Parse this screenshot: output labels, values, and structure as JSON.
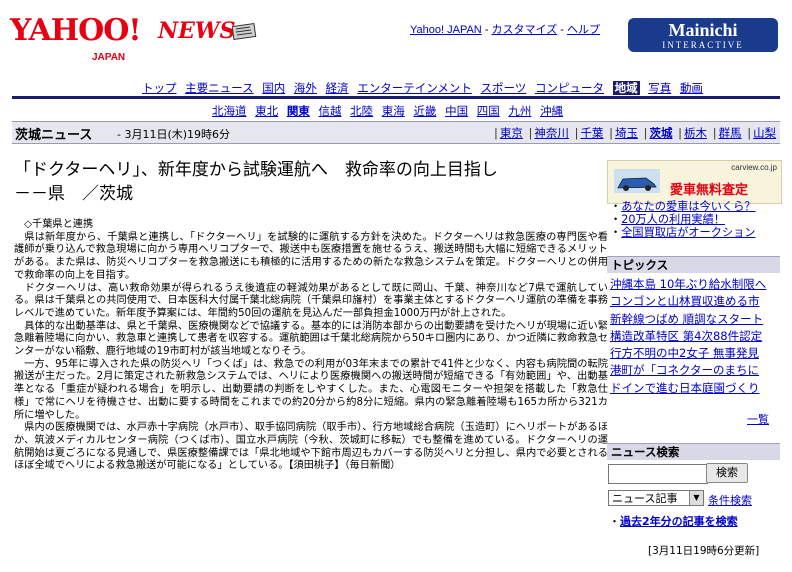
{
  "header": {
    "yahoo_logo": "YAHOO!",
    "yahoo_sub": "JAPAN",
    "news_logo": "NEWS",
    "top_links": [
      "Yahoo! JAPAN",
      "カスタマイズ",
      "ヘルプ"
    ],
    "partner_logo_1": "Mainichi",
    "partner_logo_2": "INTERACTIVE"
  },
  "nav": {
    "categories": [
      "トップ",
      "主要ニュース",
      "国内",
      "海外",
      "経済",
      "エンターテインメント",
      "スポーツ",
      "コンピュータ",
      "地域",
      "写真",
      "動画"
    ],
    "selected": "地域",
    "regions": [
      "北海道",
      "東北",
      "関東",
      "信越",
      "北陸",
      "東海",
      "近畿",
      "中国",
      "四国",
      "九州",
      "沖縄"
    ],
    "selected_region": "関東"
  },
  "section": {
    "title": "茨城ニュース",
    "date": " - 3月11日(木)19時6分",
    "prefectures": [
      "東京",
      "神奈川",
      "千葉",
      "埼玉",
      "茨城",
      "栃木",
      "群馬",
      "山梨"
    ],
    "selected_prefecture": "茨城"
  },
  "article": {
    "headline_1": "「ドクターヘリ」、新年度から試験運航へ　救命率の向上目指し",
    "headline_2": "－－県　／茨城",
    "paragraphs": [
      "　◇千葉県と連携",
      "　県は新年度から、千葉県と連携し、「ドクターヘリ」を試験的に運航する方針を決めた。ドクターヘリは救急医療の専門医や看護師が乗り込んで救急現場に向かう専用ヘリコプターで、搬送中も医療措置を施せるうえ、搬送時間も大幅に短縮できるメリットがある。また県は、防災ヘリコプターを救急搬送にも積極的に活用するための新たな救急システムを策定。ドクターヘリとの併用で救命率の向上を目指す。",
      "　ドクターヘリは、高い救命効果が得られるうえ後遺症の軽減効果があるとして既に岡山、千葉、神奈川など7県で運航している。県は千葉県との共同使用で、日本医科大付属千葉北総病院（千葉県印旛村）を事業主体とするドクターヘリ運航の準備を事務レベルで進めていた。新年度予算案には、年間約50回の運航を見込んだ一部負担金1000万円が計上された。",
      "　具体的な出動基準は、県と千葉県、医療機関などで協議する。基本的には消防本部からの出動要請を受けたヘリが現場に近い緊急離着陸場に向かい、救急車と連携して患者を収容する。運航範囲は千葉北総病院から50キロ圏内にあり、かつ近隣に救命救急センターがない稲敷、鹿行地域の19市町村が該当地域となりそう。",
      "　一方、95年に導入された県の防災ヘリ「つくば」は、救急での利用が03年末までの累計で41件と少なく、内容も病院間の転院搬送が主だった。2月に策定された新救急システムでは、ヘリにより医療機関への搬送時間が短縮できる「有効範囲」や、出動基準となる「重症が疑われる場合」を明示し、出動要請の判断をしやすくした。また、心電図モニターや担架を搭載した「救急仕様」で常にヘリを待機させ、出動に要する時間をこれまでの約20分から約8分に短縮。県内の緊急離着陸場も165カ所から321カ所に増やした。",
      "　県内の医療機関では、水戸赤十字病院（水戸市）、取手協同病院（取手市）、行方地域総合病院（玉造町）にヘリポートがあるほか、筑波メディカルセンター病院（つくば市）、国立水戸病院（今秋、茨城町に移転）でも整備を進めている。ドクターヘリの運航開始は夏ごろになる見通しで、県医療整備課では「県北地域や下館市周辺もカバーする防災ヘリと分担し、県内で必要とされるほぼ全域でヘリによる救急搬送が可能になる」としている。【須田桃子】（毎日新聞）"
    ],
    "updated": "[3月11日19時6分更新]"
  },
  "sidebar": {
    "ad_brand": "carview.co.jp",
    "ad_text": "愛車無料査定",
    "ad_links": [
      "あなたの愛車は今いくら？",
      "20万人の利用実績！",
      "全国買取店がオークション"
    ],
    "topics_header": "トピックス",
    "topics": [
      "沖縄本島 10年ぶり給水制限へ",
      "コンゴンと山林買収進める市",
      "新幹線つばめ 順調なスタート",
      "構造改革特区 第4次88件認定",
      "行方不明の中2女子 無事発見",
      "港町が「コネクターのまちに",
      "ドインで進む日本庭園づくり"
    ],
    "more": "一覧",
    "search_header": "ニュース検索",
    "search_button": "検索",
    "search_select": "ニュース記事",
    "condition_link": "条件検索",
    "past_link": "過去2年分の記事を検索"
  }
}
